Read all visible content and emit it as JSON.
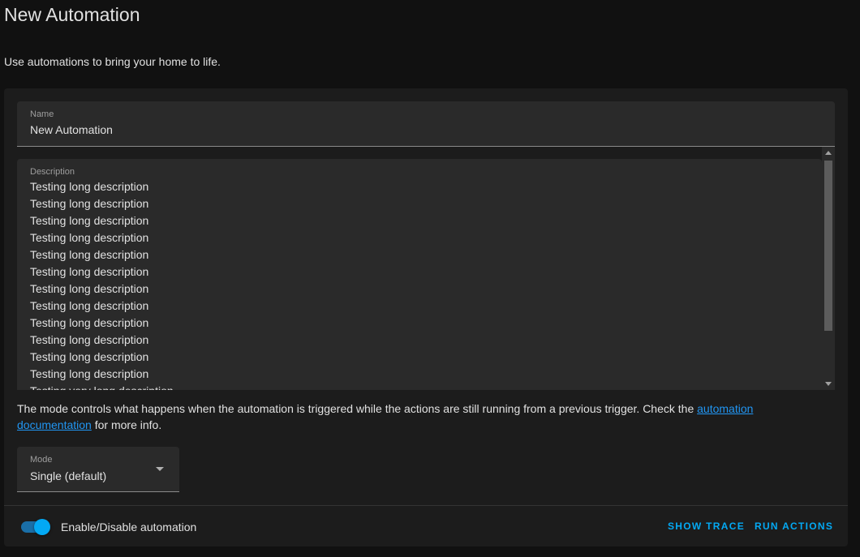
{
  "header": {
    "title": "New Automation",
    "intro": "Use automations to bring your home to life."
  },
  "name_field": {
    "label": "Name",
    "value": "New Automation"
  },
  "description_field": {
    "label": "Description",
    "lines": [
      "Testing long description",
      "Testing long description",
      "Testing long description",
      "Testing long description",
      "Testing long description",
      "Testing long description",
      "Testing long description",
      "Testing long description",
      "Testing long description",
      "Testing long description",
      "Testing long description",
      "Testing long description",
      "Testing very long description"
    ]
  },
  "mode_help": {
    "text_before": "The mode controls what happens when the automation is triggered while the actions are still running from a previous trigger. Check the ",
    "link_text": "automation documentation",
    "text_after": " for more info."
  },
  "mode_field": {
    "label": "Mode",
    "value": "Single (default)"
  },
  "footer": {
    "toggle_label": "Enable/Disable automation",
    "toggle_on": true,
    "show_trace_label": "SHOW TRACE",
    "run_actions_label": "RUN ACTIONS"
  },
  "colors": {
    "accent": "#03a9f4",
    "link": "#2196f3",
    "background": "#111111",
    "card": "#1c1c1c"
  }
}
